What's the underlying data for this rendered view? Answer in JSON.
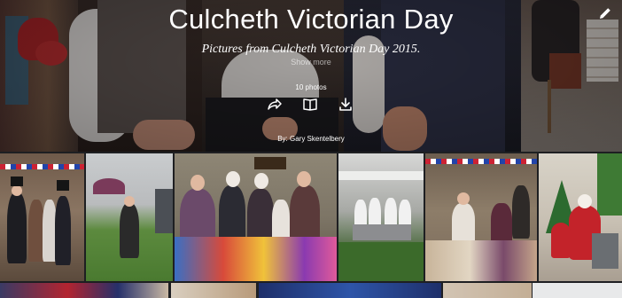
{
  "album": {
    "title": "Culcheth Victorian Day",
    "description": "Pictures from Culcheth Victorian Day 2015.",
    "show_more": "Show more",
    "photo_count": "10 photos",
    "byline": "By: Gary Skentelbery"
  },
  "actions": {
    "share_icon": "share-icon",
    "book_icon": "book-icon",
    "download_icon": "download-icon",
    "edit_icon": "pencil-icon"
  },
  "colors": {
    "title": "#ffffff",
    "grid_background": "#1e1f22"
  },
  "photos": {
    "row1_count": 6,
    "row2_count": 5
  }
}
